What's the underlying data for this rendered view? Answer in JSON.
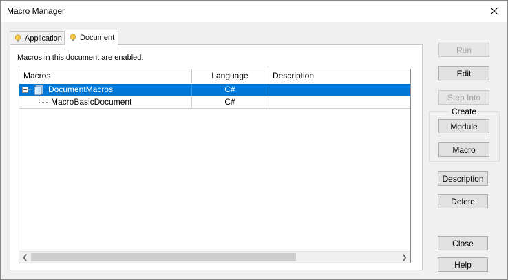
{
  "window": {
    "title": "Macro Manager"
  },
  "tabs": [
    {
      "label": "Application",
      "icon": "lightbulb-icon",
      "active": false
    },
    {
      "label": "Document",
      "icon": "lightbulb-icon",
      "active": true
    }
  ],
  "status_message": "Macros in this document are enabled.",
  "grid": {
    "columns": [
      "Macros",
      "Language",
      "Description"
    ],
    "rows": [
      {
        "name": "DocumentMacros",
        "language": "C#",
        "description": "",
        "selected": true,
        "expanded": true,
        "icon": "macro-project-icon"
      },
      {
        "name": "MacroBasicDocument",
        "language": "C#",
        "description": "",
        "selected": false
      }
    ]
  },
  "buttons": {
    "run": {
      "label": "Run",
      "enabled": false
    },
    "edit": {
      "label": "Edit",
      "enabled": true
    },
    "step_into": {
      "label": "Step Into",
      "enabled": false
    },
    "create_group": "Create",
    "module": {
      "label": "Module",
      "enabled": true
    },
    "macro": {
      "label": "Macro",
      "enabled": true
    },
    "description": {
      "label": "Description",
      "enabled": true
    },
    "delete": {
      "label": "Delete",
      "enabled": true
    },
    "close": {
      "label": "Close",
      "enabled": true
    },
    "help": {
      "label": "Help",
      "enabled": true
    }
  },
  "colors": {
    "selection": "#0078d7",
    "window_bg": "#f0f0f0",
    "panel_bg": "#ffffff"
  }
}
